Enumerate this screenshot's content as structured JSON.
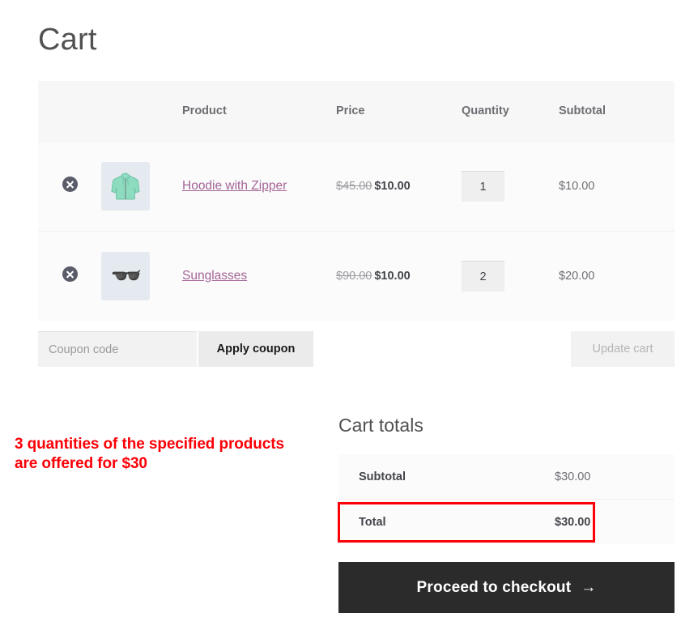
{
  "page": {
    "title": "Cart"
  },
  "cart_table": {
    "columns": [
      "",
      "",
      "Product",
      "Price",
      "Quantity",
      "Subtotal"
    ],
    "headers": {
      "product": "Product",
      "price": "Price",
      "quantity": "Quantity",
      "subtotal": "Subtotal"
    },
    "rows": [
      {
        "remove_icon": "remove-circle-icon",
        "thumbnail": "hoodie-with-zipper-thumbnail",
        "name": "Hoodie with Zipper",
        "price_original": "$45.00",
        "price_sale": "$10.00",
        "quantity": "1",
        "subtotal": "$10.00"
      },
      {
        "remove_icon": "remove-circle-icon",
        "thumbnail": "sunglasses-thumbnail",
        "name": "Sunglasses",
        "price_original": "$90.00",
        "price_sale": "$10.00",
        "quantity": "2",
        "subtotal": "$20.00"
      }
    ]
  },
  "coupon": {
    "placeholder": "Coupon code",
    "value": "",
    "apply_label": "Apply coupon",
    "update_cart_label": "Update cart"
  },
  "annotation": {
    "line1": "3 quantities of the specified products",
    "line2": "are offered for $30",
    "color": "#fb0007"
  },
  "cart_totals": {
    "heading": "Cart totals",
    "rows": [
      {
        "label": "Subtotal",
        "value": "$30.00"
      },
      {
        "label": "Total",
        "value": "$30.00"
      }
    ],
    "checkout_label": "Proceed to checkout",
    "checkout_arrow": "→",
    "highlight_color": "#fb0007"
  },
  "colors": {
    "link": "#a46497",
    "header_bg": "#f7f7f7",
    "row_bg": "#fbfbfb",
    "checkout_bg": "#2b2b2b"
  }
}
